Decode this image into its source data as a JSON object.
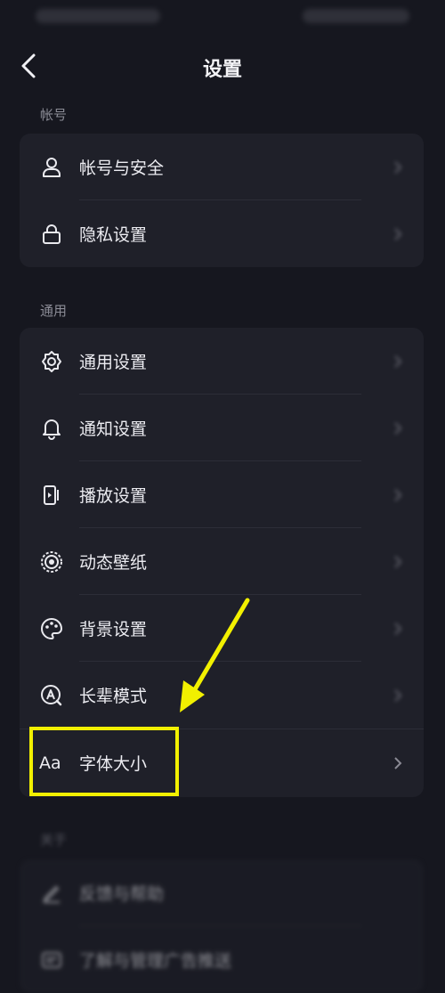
{
  "header": {
    "title": "设置"
  },
  "sections": {
    "account": {
      "label": "帐号",
      "items": [
        {
          "label": "帐号与安全",
          "icon": "user-icon"
        },
        {
          "label": "隐私设置",
          "icon": "lock-icon"
        }
      ]
    },
    "general": {
      "label": "通用",
      "items": [
        {
          "label": "通用设置",
          "icon": "gear-icon"
        },
        {
          "label": "通知设置",
          "icon": "bell-icon"
        },
        {
          "label": "播放设置",
          "icon": "play-icon"
        },
        {
          "label": "动态壁纸",
          "icon": "target-icon"
        },
        {
          "label": "背景设置",
          "icon": "palette-icon"
        },
        {
          "label": "长辈模式",
          "icon": "elder-mode-icon"
        },
        {
          "label": "字体大小",
          "icon": "font-size-icon",
          "icon_text": "Aa"
        }
      ]
    },
    "about": {
      "label": "关于",
      "items": [
        {
          "label": "反馈与帮助",
          "icon": "edit-icon"
        },
        {
          "label": "了解与管理广告推送",
          "icon": "ad-icon"
        }
      ]
    }
  },
  "colors": {
    "background": "#16171f",
    "card": "#1f2029",
    "highlight": "#f2f000"
  }
}
